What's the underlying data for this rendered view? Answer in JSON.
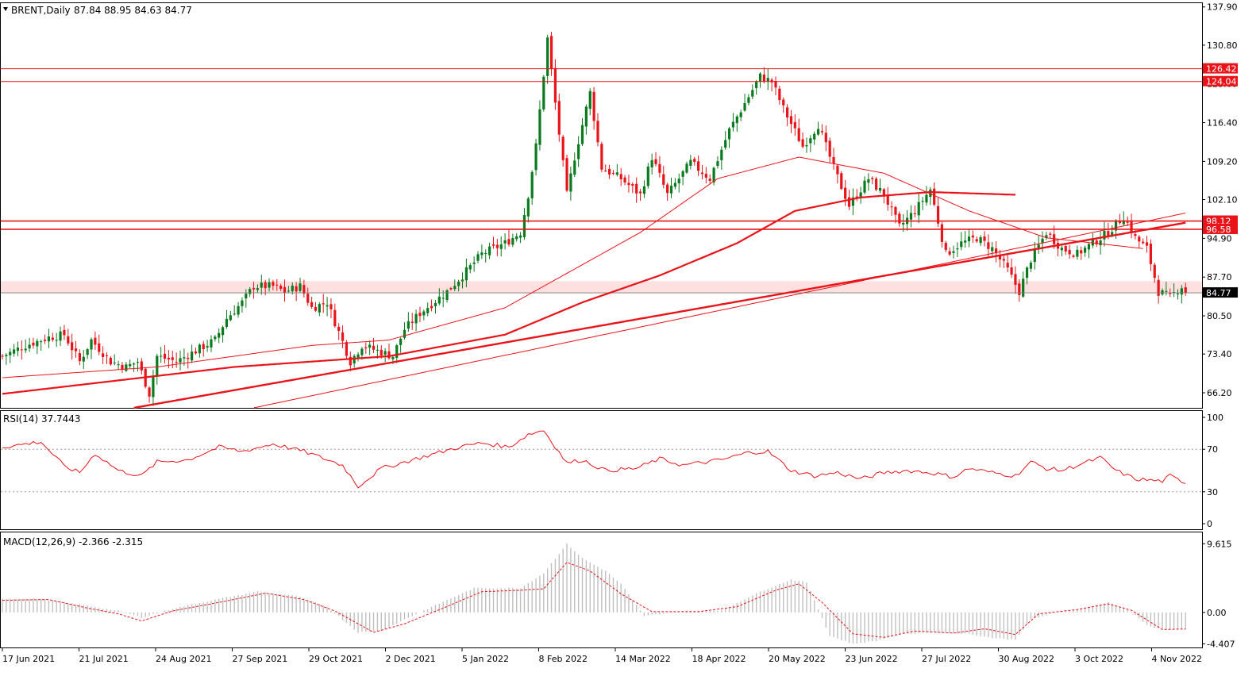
{
  "header": {
    "symbol": "BRENT,Daily",
    "ohlc": "87.84 88.95 84.63 84.77",
    "collapse_icon": "triangle-down-icon"
  },
  "colors": {
    "bull": "#0a7a1e",
    "bear": "#e8141a",
    "line": "#e8141a",
    "zone": "#fde0df",
    "grid": "#a0a0a0",
    "price_tag_bg": "#000000",
    "macd_hist": "#c0c0c0"
  },
  "chart_data": [
    {
      "type": "line",
      "panel": "price",
      "title": "BRENT,Daily",
      "x_ticks": [
        "17 Jun 2021",
        "21 Jul 2021",
        "24 Aug 2021",
        "27 Sep 2021",
        "29 Oct 2021",
        "2 Dec 2021",
        "5 Jan 2022",
        "8 Feb 2022",
        "14 Mar 2022",
        "18 Apr 2022",
        "20 May 2022",
        "23 Jun 2022",
        "27 Jul 2022",
        "30 Aug 2022",
        "3 Oct 2022",
        "4 Nov 2022"
      ],
      "y_ticks": [
        137.9,
        130.8,
        123.6,
        116.4,
        109.2,
        102.1,
        94.9,
        87.7,
        80.5,
        73.4,
        66.2
      ],
      "ylim": [
        63.4,
        138.6
      ],
      "last_price": 84.77,
      "horizontal_levels": [
        126.42,
        124.04,
        98.12,
        96.58
      ],
      "support_zone": [
        84.77,
        86.95
      ],
      "grid": false,
      "close_series": [
        [
          0,
          73
        ],
        [
          6,
          75
        ],
        [
          12,
          76.5
        ],
        [
          16,
          77
        ],
        [
          20,
          72
        ],
        [
          23,
          76
        ],
        [
          28,
          72
        ],
        [
          32,
          71
        ],
        [
          35,
          72
        ],
        [
          38,
          66
        ],
        [
          40,
          73
        ],
        [
          45,
          72
        ],
        [
          50,
          74
        ],
        [
          55,
          76
        ],
        [
          58,
          80
        ],
        [
          62,
          83
        ],
        [
          65,
          86
        ],
        [
          70,
          86
        ],
        [
          73,
          85
        ],
        [
          77,
          86
        ],
        [
          80,
          82
        ],
        [
          84,
          83
        ],
        [
          90,
          72
        ],
        [
          93,
          75
        ],
        [
          97,
          74
        ],
        [
          101,
          73
        ],
        [
          104,
          78
        ],
        [
          108,
          81
        ],
        [
          115,
          85
        ],
        [
          119,
          88
        ],
        [
          124,
          92
        ],
        [
          130,
          94
        ],
        [
          134,
          96
        ],
        [
          136,
          103
        ],
        [
          138,
          112
        ],
        [
          141,
          132
        ],
        [
          143,
          120
        ],
        [
          146,
          103
        ],
        [
          148,
          110
        ],
        [
          152,
          122
        ],
        [
          155,
          108
        ],
        [
          160,
          106
        ],
        [
          165,
          103
        ],
        [
          168,
          110
        ],
        [
          172,
          103
        ],
        [
          178,
          109
        ],
        [
          183,
          106
        ],
        [
          188,
          115
        ],
        [
          192,
          120
        ],
        [
          196,
          125
        ],
        [
          199,
          124
        ],
        [
          202,
          119
        ],
        [
          207,
          112
        ],
        [
          211,
          116
        ],
        [
          215,
          108
        ],
        [
          219,
          101
        ],
        [
          224,
          106
        ],
        [
          228,
          103
        ],
        [
          232,
          97
        ],
        [
          236,
          100
        ],
        [
          240,
          104
        ],
        [
          244,
          92
        ],
        [
          248,
          94
        ],
        [
          252,
          95
        ],
        [
          256,
          93
        ],
        [
          260,
          89
        ],
        [
          263,
          85
        ],
        [
          266,
          91
        ],
        [
          270,
          96
        ],
        [
          274,
          93
        ],
        [
          278,
          92
        ],
        [
          282,
          94
        ],
        [
          286,
          96
        ],
        [
          290,
          99
        ],
        [
          293,
          95
        ],
        [
          296,
          93
        ],
        [
          299,
          85
        ],
        [
          302,
          84
        ],
        [
          305,
          86
        ],
        [
          306,
          84.77
        ]
      ],
      "series": [
        {
          "values": [
            [
              0,
              66
            ],
            [
              60,
              71
            ],
            [
              100,
              73
            ],
            [
              130,
              77
            ],
            [
              150,
              83
            ],
            [
              170,
              88
            ],
            [
              190,
              94
            ],
            [
              205,
              100
            ],
            [
              222,
              102.5
            ],
            [
              240,
              103.5
            ],
            [
              262,
              103
            ]
          ]
        },
        {
          "values": [
            [
              0,
              69
            ],
            [
              40,
              71
            ],
            [
              80,
              75
            ],
            [
              100,
              76
            ],
            [
              130,
              82
            ],
            [
              150,
              90
            ],
            [
              165,
              96
            ],
            [
              185,
              106
            ],
            [
              206,
              110
            ],
            [
              228,
              107
            ],
            [
              250,
              100
            ],
            [
              270,
              95
            ],
            [
              295,
              93
            ]
          ]
        },
        {
          "values": [
            [
              34,
              63.4
            ],
            [
              306,
              97.8
            ]
          ]
        },
        {
          "values": [
            [
              65,
              63.4
            ],
            [
              306,
              99.6
            ]
          ]
        }
      ]
    },
    {
      "type": "line",
      "panel": "rsi",
      "title": "RSI(14) 37.7443",
      "y_ticks": [
        100,
        70,
        30,
        0
      ],
      "ylim": [
        0,
        100
      ],
      "levels": [
        70,
        30
      ],
      "values": [
        [
          0,
          72
        ],
        [
          10,
          77
        ],
        [
          16,
          54
        ],
        [
          20,
          48
        ],
        [
          24,
          66
        ],
        [
          30,
          50
        ],
        [
          36,
          45
        ],
        [
          40,
          58
        ],
        [
          48,
          60
        ],
        [
          56,
          72
        ],
        [
          62,
          68
        ],
        [
          70,
          75
        ],
        [
          78,
          68
        ],
        [
          88,
          55
        ],
        [
          92,
          35
        ],
        [
          98,
          52
        ],
        [
          104,
          58
        ],
        [
          112,
          66
        ],
        [
          118,
          72
        ],
        [
          124,
          76
        ],
        [
          131,
          72
        ],
        [
          136,
          84
        ],
        [
          140,
          88
        ],
        [
          146,
          57
        ],
        [
          150,
          60
        ],
        [
          156,
          50
        ],
        [
          164,
          52
        ],
        [
          170,
          61
        ],
        [
          176,
          55
        ],
        [
          186,
          60
        ],
        [
          193,
          67
        ],
        [
          198,
          68
        ],
        [
          204,
          50
        ],
        [
          210,
          45
        ],
        [
          216,
          48
        ],
        [
          222,
          42
        ],
        [
          228,
          48
        ],
        [
          234,
          50
        ],
        [
          240,
          48
        ],
        [
          246,
          44
        ],
        [
          250,
          52
        ],
        [
          256,
          48
        ],
        [
          262,
          45
        ],
        [
          266,
          58
        ],
        [
          270,
          52
        ],
        [
          274,
          50
        ],
        [
          278,
          55
        ],
        [
          284,
          62
        ],
        [
          288,
          50
        ],
        [
          293,
          42
        ],
        [
          300,
          40
        ],
        [
          302,
          45
        ],
        [
          306,
          37.74
        ]
      ]
    },
    {
      "type": "bar",
      "panel": "macd",
      "title": "MACD(12,26,9) -2.366 -2.315",
      "y_ticks": [
        9.615,
        0.0,
        -4.407
      ],
      "ylim": [
        -4.8,
        10.2
      ],
      "histogram": [
        [
          0,
          1.9
        ],
        [
          10,
          1.9
        ],
        [
          20,
          1.1
        ],
        [
          30,
          0.2
        ],
        [
          36,
          -0.7
        ],
        [
          44,
          0.5
        ],
        [
          56,
          1.9
        ],
        [
          66,
          2.9
        ],
        [
          76,
          2.3
        ],
        [
          84,
          0.8
        ],
        [
          92,
          -2.8
        ],
        [
          98,
          -2.6
        ],
        [
          104,
          -1.0
        ],
        [
          112,
          1.0
        ],
        [
          122,
          3.4
        ],
        [
          134,
          3.4
        ],
        [
          140,
          5.5
        ],
        [
          146,
          9.6
        ],
        [
          150,
          7.6
        ],
        [
          156,
          5.8
        ],
        [
          160,
          4.0
        ],
        [
          166,
          -0.5
        ],
        [
          176,
          0.2
        ],
        [
          186,
          0.3
        ],
        [
          196,
          2.9
        ],
        [
          204,
          4.6
        ],
        [
          208,
          4.2
        ],
        [
          214,
          -3.3
        ],
        [
          220,
          -4.4
        ],
        [
          226,
          -4.0
        ],
        [
          232,
          -3.1
        ],
        [
          240,
          -2.8
        ],
        [
          250,
          -3.0
        ],
        [
          256,
          -3.6
        ],
        [
          262,
          -3.8
        ],
        [
          266,
          -1.0
        ],
        [
          272,
          -0.1
        ],
        [
          280,
          0.6
        ],
        [
          286,
          1.4
        ],
        [
          292,
          0.2
        ],
        [
          296,
          -1.8
        ],
        [
          300,
          -2.4
        ],
        [
          306,
          -2.37
        ]
      ],
      "signal": [
        [
          0,
          1.7
        ],
        [
          12,
          1.8
        ],
        [
          22,
          0.6
        ],
        [
          30,
          -0.2
        ],
        [
          36,
          -1.2
        ],
        [
          44,
          0.2
        ],
        [
          58,
          1.6
        ],
        [
          68,
          2.7
        ],
        [
          78,
          1.8
        ],
        [
          86,
          0.2
        ],
        [
          96,
          -2.8
        ],
        [
          104,
          -1.6
        ],
        [
          114,
          0.6
        ],
        [
          124,
          2.9
        ],
        [
          134,
          3.1
        ],
        [
          140,
          3.3
        ],
        [
          146,
          7.0
        ],
        [
          152,
          5.8
        ],
        [
          160,
          2.6
        ],
        [
          168,
          0.1
        ],
        [
          180,
          0.1
        ],
        [
          190,
          0.8
        ],
        [
          200,
          3.1
        ],
        [
          206,
          4.0
        ],
        [
          212,
          1.4
        ],
        [
          220,
          -3.0
        ],
        [
          228,
          -3.5
        ],
        [
          236,
          -2.6
        ],
        [
          246,
          -2.9
        ],
        [
          254,
          -2.3
        ],
        [
          262,
          -3.1
        ],
        [
          268,
          -0.2
        ],
        [
          278,
          0.4
        ],
        [
          286,
          1.2
        ],
        [
          292,
          0.3
        ],
        [
          300,
          -2.4
        ],
        [
          306,
          -2.32
        ]
      ]
    }
  ]
}
